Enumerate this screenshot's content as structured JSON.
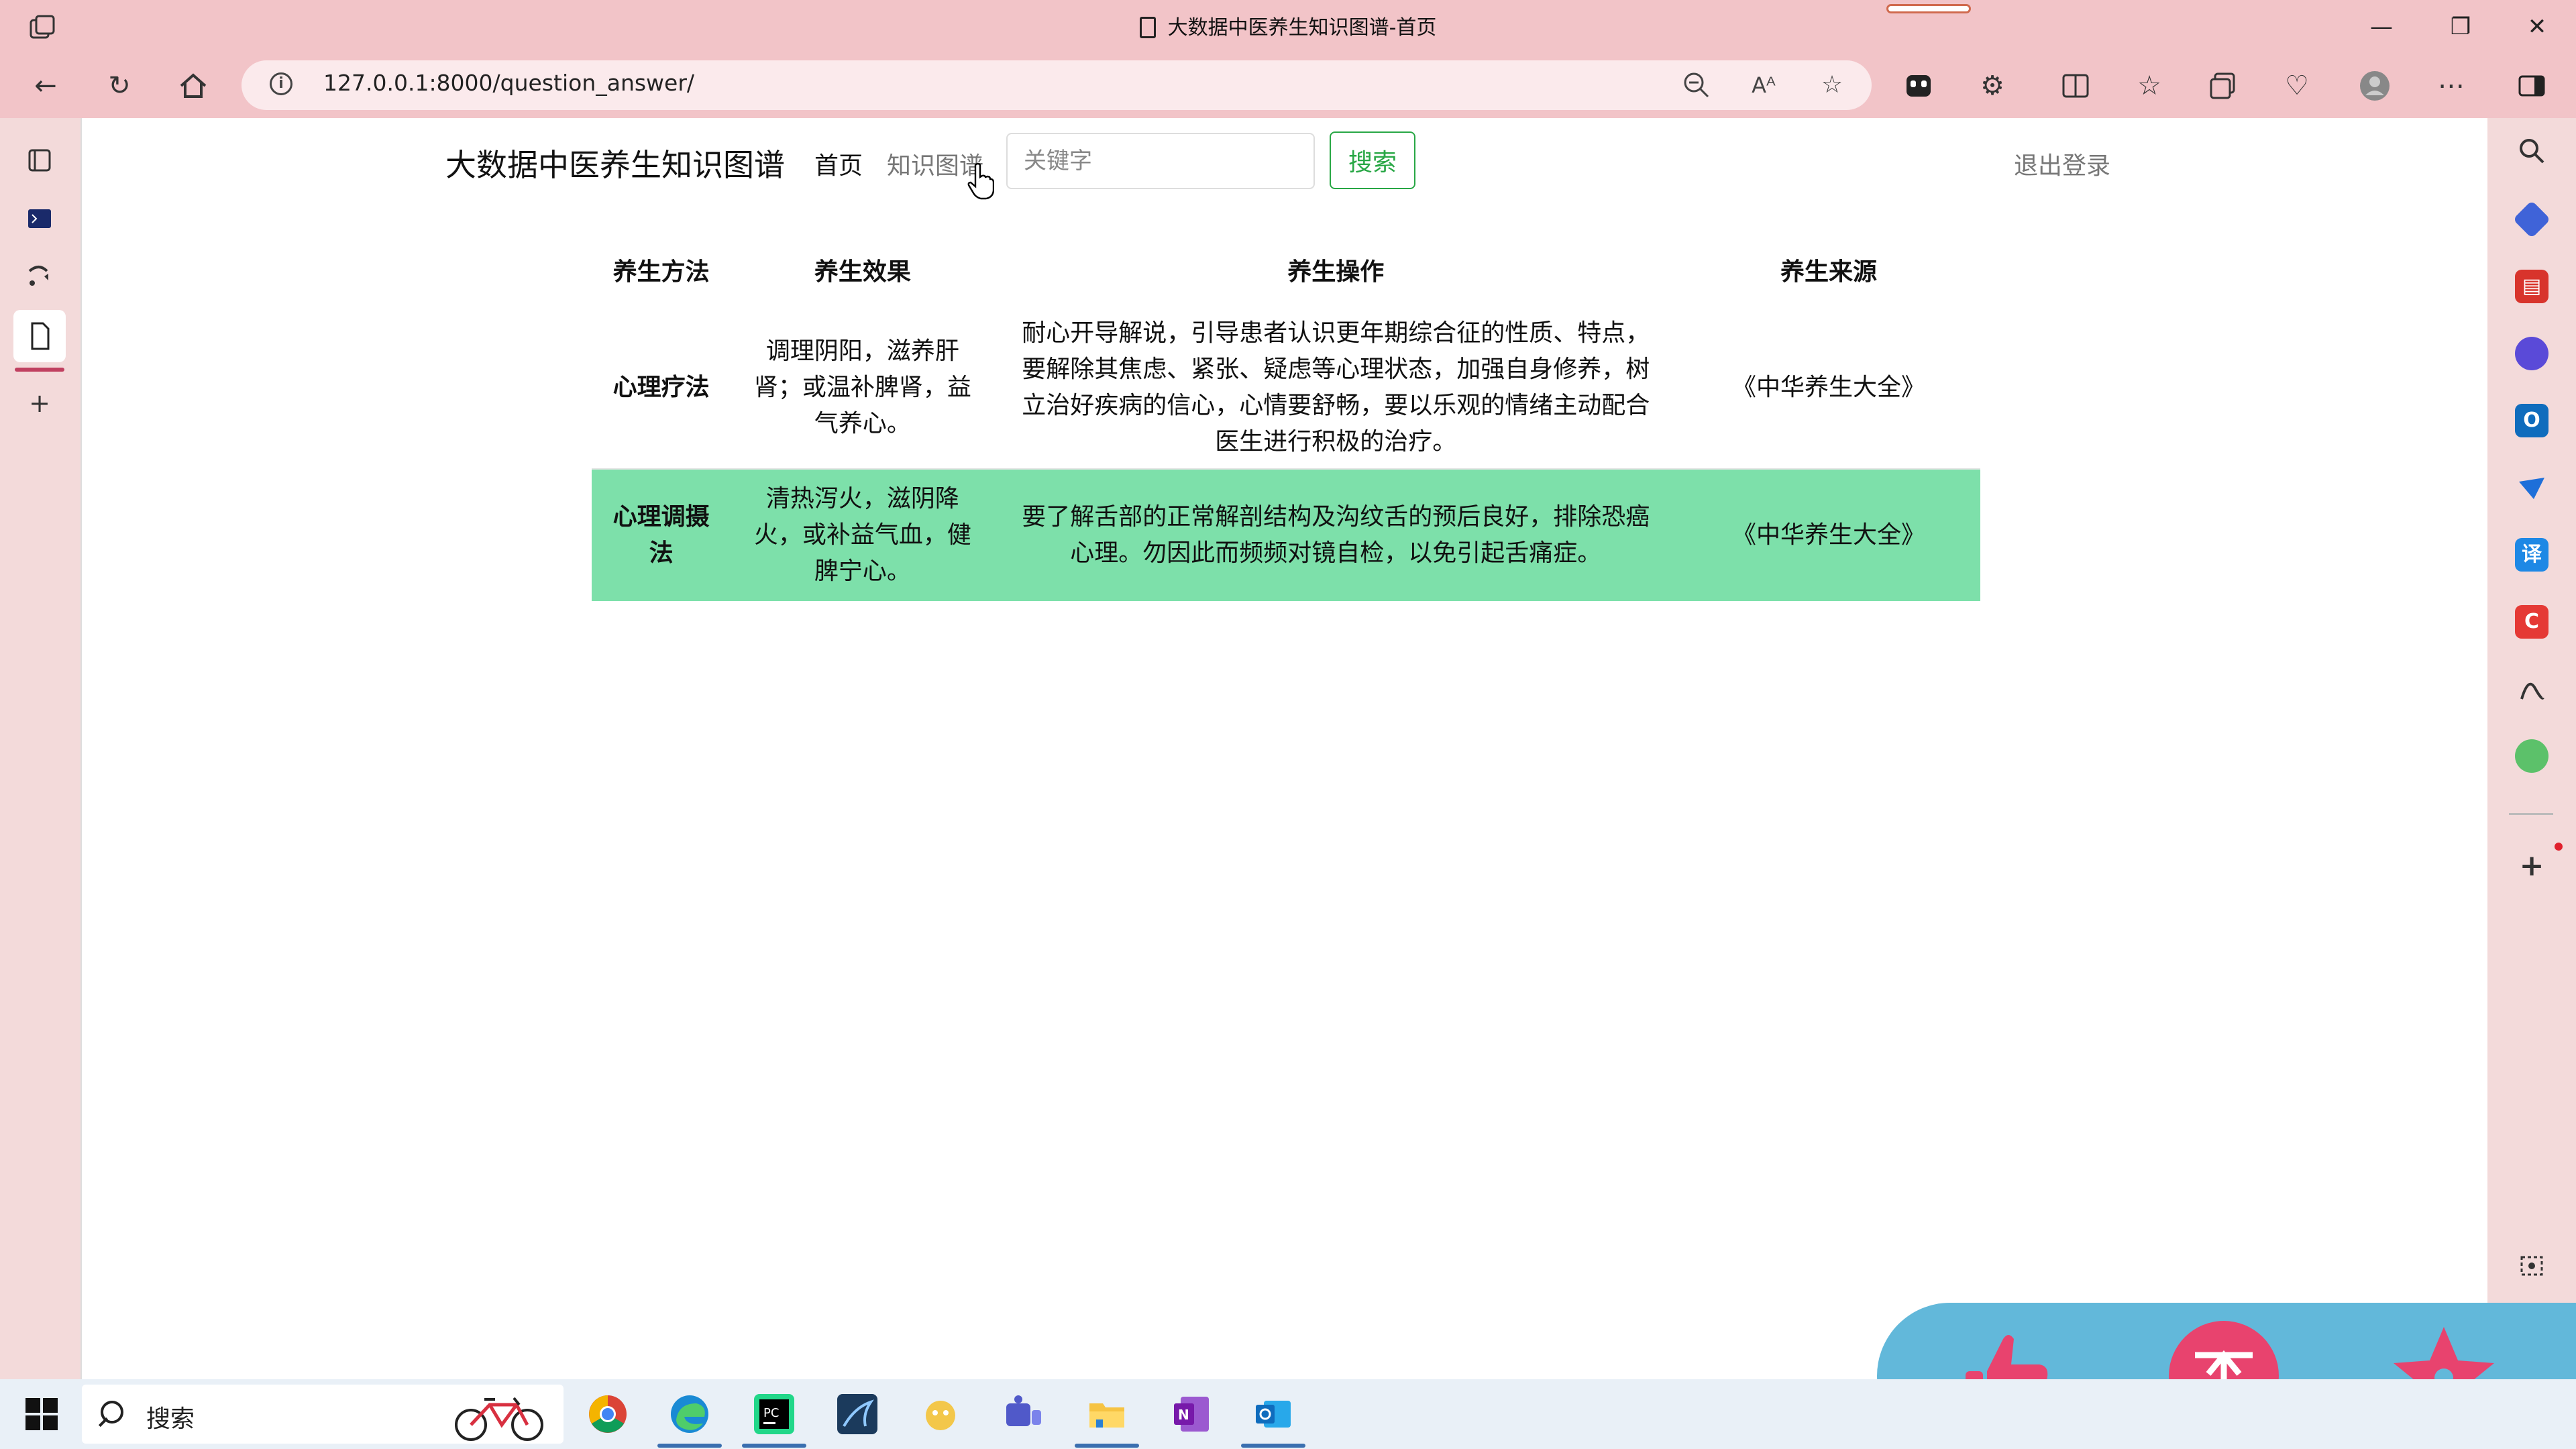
{
  "window": {
    "title": "大数据中医养生知识图谱-首页",
    "controls": {
      "minimize": "—",
      "restore": "❐",
      "close": "✕"
    }
  },
  "toolbar": {
    "url": "127.0.0.1:8000/question_answer/",
    "icons": [
      "back-icon",
      "refresh-icon",
      "home-icon",
      "zoom-out-icon",
      "read-aloud-icon",
      "favorite-star-icon",
      "copilot-icon",
      "extensions-icon",
      "split-screen-icon",
      "favorites-icon",
      "collections-icon",
      "performance-icon",
      "profile-icon",
      "more-icon",
      "sidebar-toggle-icon"
    ],
    "read_aloud_glyph": "Aᴬ"
  },
  "navbar": {
    "brand": "大数据中医养生知识图谱",
    "home": "首页",
    "knowledge_graph": "知识图谱",
    "search_placeholder": "关键字",
    "search_button": "搜索",
    "logout": "退出登录"
  },
  "table": {
    "headers": [
      "养生方法",
      "养生效果",
      "养生操作",
      "养生来源"
    ],
    "rows": [
      {
        "method": "心理疗法",
        "effect": "调理阴阳，滋养肝肾；或温补脾肾，益气养心。",
        "operation": "耐心开导解说，引导患者认识更年期综合征的性质、特点，要解除其焦虑、紧张、疑虑等心理状态，加强自身修养，树立治好疾病的信心，心情要舒畅，要以乐观的情绪主动配合医生进行积极的治疗。",
        "source": "《中华养生大全》"
      },
      {
        "method": "心理调摄法",
        "effect": "清热泻火，滋阴降火，或补益气血，健脾宁心。",
        "operation": "要了解舌部的正常解剖结构及沟纹舌的预后良好，排除恐癌心理。勿因此而频频对镜自检，以免引起舌痛症。",
        "source": "《中华养生大全》"
      }
    ]
  },
  "taskbar": {
    "search_label": "搜索",
    "apps": [
      "chrome",
      "edge",
      "pycharm",
      "navicat",
      "app-5",
      "teams",
      "file-explorer",
      "onenote",
      "outlook"
    ]
  },
  "colors": {
    "chrome_bg": "#f2c4c8",
    "highlight_row": "#7de0aa",
    "search_green": "#28a745",
    "fab_bg": "#62b8da",
    "fab_icon": "#e8436e"
  }
}
